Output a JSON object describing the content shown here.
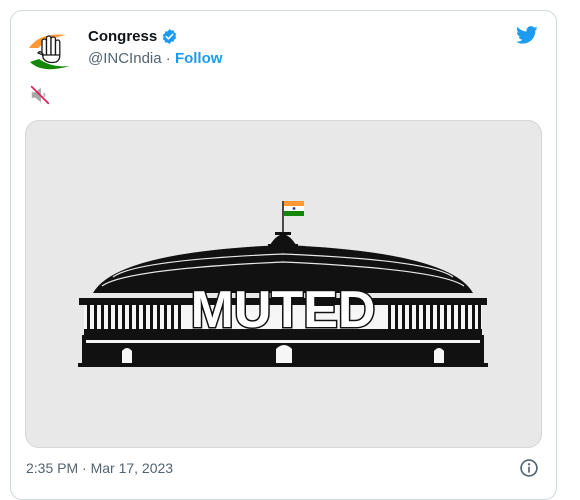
{
  "tweet": {
    "display_name": "Congress",
    "handle": "@INCIndia",
    "separator": "·",
    "follow_label": "Follow",
    "verified": true,
    "image_text": "MUTED",
    "timestamp": "2:35 PM · Mar 17, 2023"
  },
  "colors": {
    "accent": "#1d9bf0",
    "flag_saffron": "#ff9933",
    "flag_green": "#138808",
    "parliament": "#111111",
    "media_bg": "#e8e8e8"
  },
  "icons": [
    "congress-logo",
    "verified-badge-icon",
    "twitter-bird-icon",
    "muted-speaker-icon",
    "info-icon"
  ]
}
